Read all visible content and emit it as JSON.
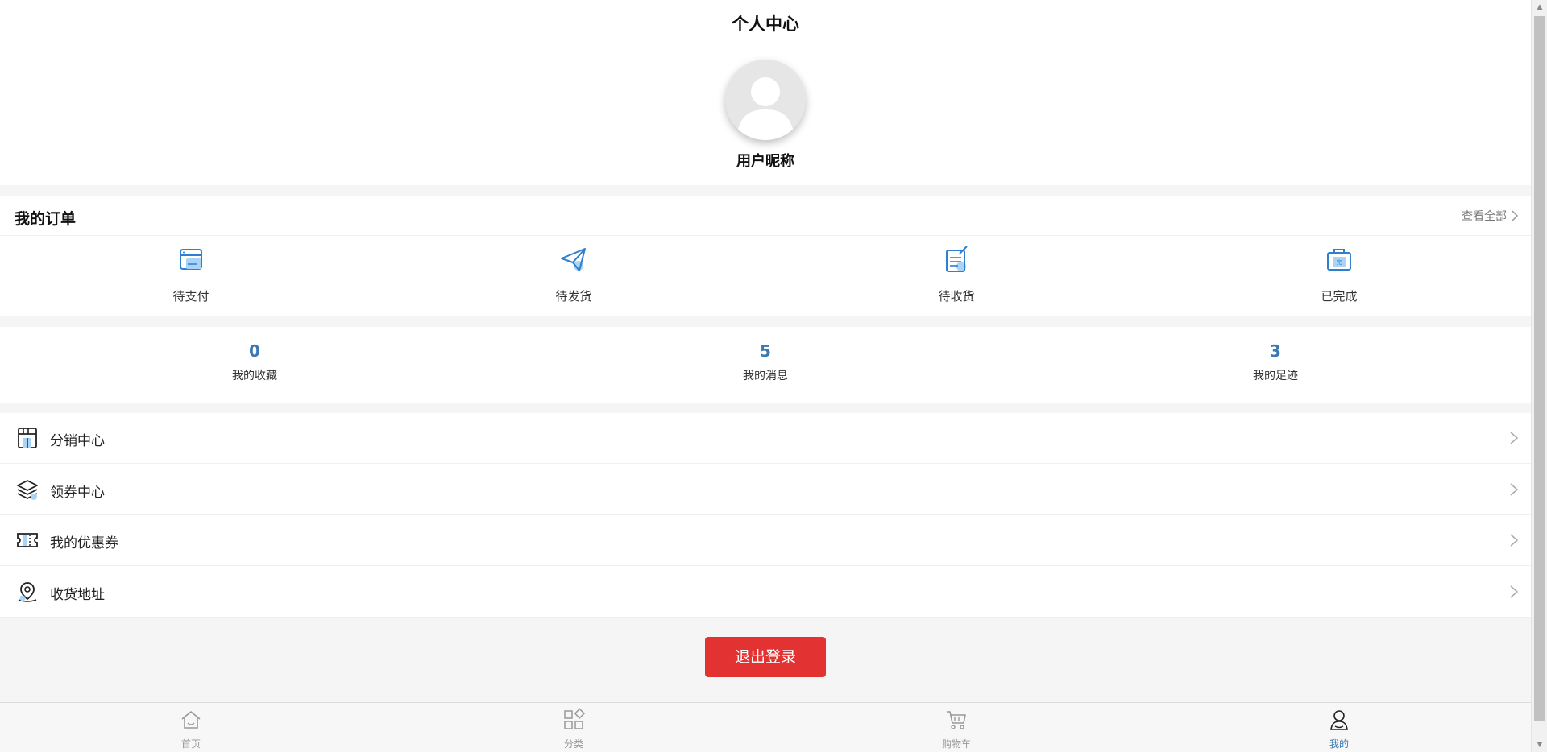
{
  "header": {
    "title": "个人中心",
    "nickname": "用户昵称"
  },
  "orders": {
    "title": "我的订单",
    "view_all": "查看全部",
    "items": [
      {
        "label": "待支付",
        "icon": "wallet-icon"
      },
      {
        "label": "待发货",
        "icon": "paper-plane-icon"
      },
      {
        "label": "待收货",
        "icon": "clipboard-icon"
      },
      {
        "label": "已完成",
        "icon": "completed-bag-icon"
      }
    ]
  },
  "stats": [
    {
      "value": "0",
      "label": "我的收藏"
    },
    {
      "value": "5",
      "label": "我的消息"
    },
    {
      "value": "3",
      "label": "我的足迹"
    }
  ],
  "menu": [
    {
      "label": "分销中心",
      "icon": "store-icon"
    },
    {
      "label": "领券中心",
      "icon": "layers-icon"
    },
    {
      "label": "我的优惠券",
      "icon": "ticket-icon"
    },
    {
      "label": "收货地址",
      "icon": "location-pin-icon"
    }
  ],
  "logout": {
    "label": "退出登录"
  },
  "tabbar": [
    {
      "label": "首页",
      "icon": "home-icon",
      "active": false
    },
    {
      "label": "分类",
      "icon": "grid-icon",
      "active": false
    },
    {
      "label": "购物车",
      "icon": "cart-icon",
      "active": false
    },
    {
      "label": "我的",
      "icon": "user-icon",
      "active": true
    }
  ],
  "colors": {
    "accent": "#3a78b4",
    "logout": "#e23232",
    "icon_blue": "#2f7fd0",
    "icon_light": "#a9d4f5"
  }
}
